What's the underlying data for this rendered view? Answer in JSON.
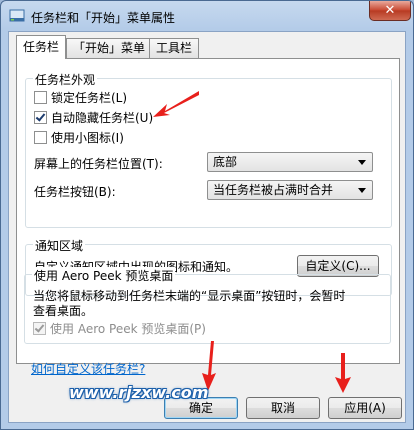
{
  "window": {
    "title": "任务栏和「开始」菜单属性",
    "close_label": "✕"
  },
  "tabs": [
    {
      "label": "任务栏",
      "active": true
    },
    {
      "label": "「开始」菜单",
      "active": false
    },
    {
      "label": "工具栏",
      "active": false
    }
  ],
  "appearance": {
    "group_title": "任务栏外观",
    "lock_taskbar": {
      "label": "锁定任务栏(L)",
      "checked": false
    },
    "auto_hide": {
      "label": "自动隐藏任务栏(U)",
      "checked": true
    },
    "small_icons": {
      "label": "使用小图标(I)",
      "checked": false
    },
    "location_label": "屏幕上的任务栏位置(T):",
    "location_value": "底部",
    "buttons_label": "任务栏按钮(B):",
    "buttons_value": "当任务栏被占满时合并"
  },
  "notification": {
    "group_title": "通知区域",
    "description": "自定义通知区域中出现的图标和通知。",
    "customize_button": "自定义(C)..."
  },
  "aero_peek": {
    "group_title": "使用 Aero Peek 预览桌面",
    "description_line1": "当您将鼠标移动到任务栏末端的“显示桌面”按钮时，会暂时",
    "description_line2": "查看桌面。",
    "checkbox_label": "使用 Aero Peek 预览桌面(P)",
    "checked": true
  },
  "help_link": "如何自定义该任务栏?",
  "buttons": {
    "ok": "确定",
    "cancel": "取消",
    "apply": "应用(A)"
  },
  "watermark": "www.rjzxw.com",
  "colors": {
    "arrow_red": "#e8201c",
    "link_blue": "#0066cc"
  }
}
